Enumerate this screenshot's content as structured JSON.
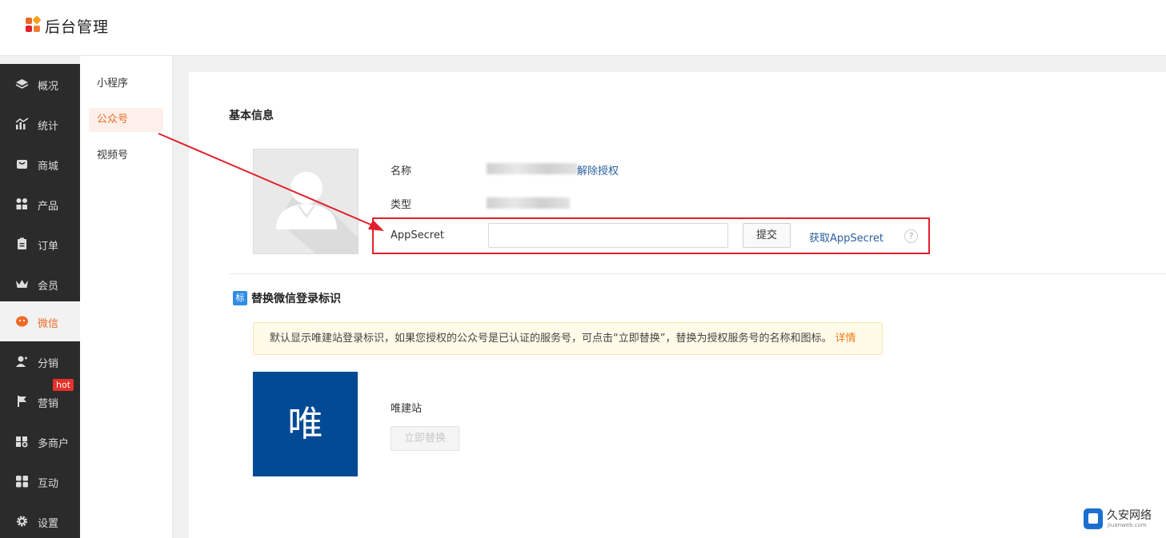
{
  "header": {
    "brand": "后台管理",
    "colors": [
      "#ee6a24",
      "#f4a21e",
      "#e2202a",
      "#f07c33"
    ]
  },
  "sidebar": {
    "items": [
      {
        "label": "概况",
        "icon": "layers-icon"
      },
      {
        "label": "统计",
        "icon": "chart-icon"
      },
      {
        "label": "商城",
        "icon": "shop-icon"
      },
      {
        "label": "产品",
        "icon": "grid-icon"
      },
      {
        "label": "订单",
        "icon": "order-icon"
      },
      {
        "label": "会员",
        "icon": "crown-icon"
      },
      {
        "label": "微信",
        "icon": "wechat-icon"
      },
      {
        "label": "分销",
        "icon": "user-icon"
      },
      {
        "label": "营销",
        "icon": "flag-icon"
      },
      {
        "label": "多商户",
        "icon": "store-plus-icon"
      },
      {
        "label": "互动",
        "icon": "apps-icon"
      },
      {
        "label": "设置",
        "icon": "gear-icon"
      }
    ],
    "active_index": 6,
    "hot_badge": "hot"
  },
  "subnav": {
    "items": [
      "小程序",
      "公众号",
      "视频号"
    ],
    "active_index": 1
  },
  "basic": {
    "title": "基本信息",
    "name_label": "名称",
    "type_label": "类型",
    "unbind_link": "解除授权",
    "appsecret_label": "AppSecret",
    "appsecret_value": "",
    "submit_label": "提交",
    "get_secret_link": "获取AppSecret",
    "help_symbol": "?"
  },
  "replace": {
    "tag": "标",
    "title": "替换微信登录标识",
    "notice": "默认显示唯建站登录标识，如果您授权的公众号是已认证的服务号，可点击“立即替换”，替换为授权服务号的名称和图标。",
    "notice_link": "详情",
    "tile_char": "唯",
    "site_name": "唯建站",
    "replace_button": "立即替换"
  },
  "watermark": {
    "name": "久安网络",
    "domain": "jiuanweb.com"
  }
}
